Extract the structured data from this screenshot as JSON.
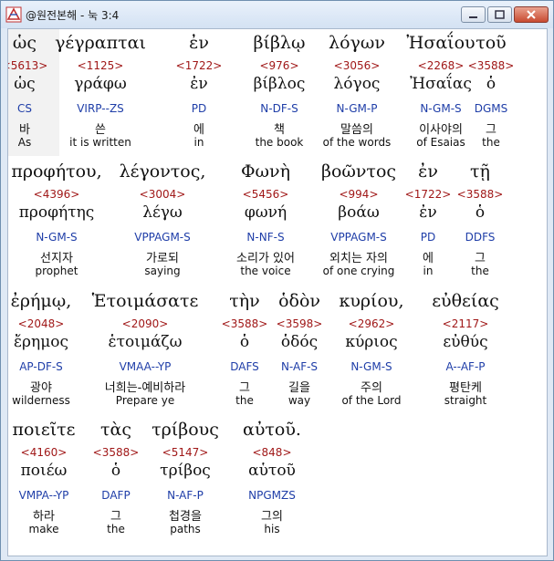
{
  "window": {
    "title": "@원전본해 - 눅 3:4"
  },
  "rows": [
    [
      {
        "greek": "ὡς",
        "strong": "<5613>",
        "lemma": "ὡς",
        "morph": "CS",
        "korean": "바",
        "english": "As"
      },
      {
        "greek": "γέγραπται",
        "strong": "<1125>",
        "lemma": "γράφω",
        "morph": "VIRP--ZS",
        "korean": "쓴",
        "english": "it is written"
      },
      {
        "greek": "ἐν",
        "strong": "<1722>",
        "lemma": "ἐν",
        "morph": "PD",
        "korean": "에",
        "english": "in"
      },
      {
        "greek": "βίβλῳ",
        "strong": "<976>",
        "lemma": "βίβλος",
        "morph": "N-DF-S",
        "korean": "책",
        "english": "the book"
      },
      {
        "greek": "λόγων",
        "strong": "<3056>",
        "lemma": "λόγος",
        "morph": "N-GM-P",
        "korean": "말씀의",
        "english": "of the words"
      },
      {
        "greek": "Ἠσαΐου",
        "strong": "<2268>",
        "lemma": "Ἠσαΐας",
        "morph": "N-GM-S",
        "korean": "이사야의",
        "english": "of Esaias"
      },
      {
        "greek": "τοῦ",
        "strong": "<3588>",
        "lemma": "ὁ",
        "morph": "DGMS",
        "korean": "그",
        "english": "the"
      }
    ],
    [
      {
        "greek": "προφήτου,",
        "strong": "<4396>",
        "lemma": "προφήτης",
        "morph": "N-GM-S",
        "korean": "선지자",
        "english": "prophet"
      },
      {
        "greek": "λέγοντος,",
        "strong": "<3004>",
        "lemma": "λέγω",
        "morph": "VPPAGM-S",
        "korean": "가로되",
        "english": "saying"
      },
      {
        "greek": "Φωνὴ",
        "strong": "<5456>",
        "lemma": "φωνή",
        "morph": "N-NF-S",
        "korean": "소리가 있어",
        "english": "the voice"
      },
      {
        "greek": "βοῶντος",
        "strong": "<994>",
        "lemma": "βοάω",
        "morph": "VPPAGM-S",
        "korean": "외치는 자의",
        "english": "of one crying"
      },
      {
        "greek": "ἐν",
        "strong": "<1722>",
        "lemma": "ἐν",
        "morph": "PD",
        "korean": "에",
        "english": "in"
      },
      {
        "greek": "τῇ",
        "strong": "<3588>",
        "lemma": "ὁ",
        "morph": "DDFS",
        "korean": "그",
        "english": "the"
      }
    ],
    [
      {
        "greek": "ἐρήμῳ,",
        "strong": "<2048>",
        "lemma": "ἔρημος",
        "morph": "AP-DF-S",
        "korean": "광야",
        "english": "wilderness"
      },
      {
        "greek": "Ἑτοιμάσατε",
        "strong": "<2090>",
        "lemma": "ἑτοιμάζω",
        "morph": "VMAA--YP",
        "korean": "너희는-예비하라",
        "english": "Prepare ye"
      },
      {
        "greek": "τὴν",
        "strong": "<3588>",
        "lemma": "ὁ",
        "morph": "DAFS",
        "korean": "그",
        "english": "the"
      },
      {
        "greek": "ὁδὸν",
        "strong": "<3598>",
        "lemma": "ὁδός",
        "morph": "N-AF-S",
        "korean": "길을",
        "english": "way"
      },
      {
        "greek": "κυρίου,",
        "strong": "<2962>",
        "lemma": "κύριος",
        "morph": "N-GM-S",
        "korean": "주의",
        "english": "of the Lord"
      },
      {
        "greek": "εὐθείας",
        "strong": "<2117>",
        "lemma": "εὐθύς",
        "morph": "A--AF-P",
        "korean": "평탄케",
        "english": "straight"
      }
    ],
    [
      {
        "greek": "ποιεῖτε",
        "strong": "<4160>",
        "lemma": "ποιέω",
        "morph": "VMPA--YP",
        "korean": "하라",
        "english": "make"
      },
      {
        "greek": "τὰς",
        "strong": "<3588>",
        "lemma": "ὁ",
        "morph": "DAFP",
        "korean": "그",
        "english": "the"
      },
      {
        "greek": "τρίβους",
        "strong": "<5147>",
        "lemma": "τρίβος",
        "morph": "N-AF-P",
        "korean": "첩경을",
        "english": "paths"
      },
      {
        "greek": "αὐτοῦ.",
        "strong": "<848>",
        "lemma": "αὑτοῦ",
        "morph": "NPGMZS",
        "korean": "그의",
        "english": "his"
      }
    ]
  ]
}
